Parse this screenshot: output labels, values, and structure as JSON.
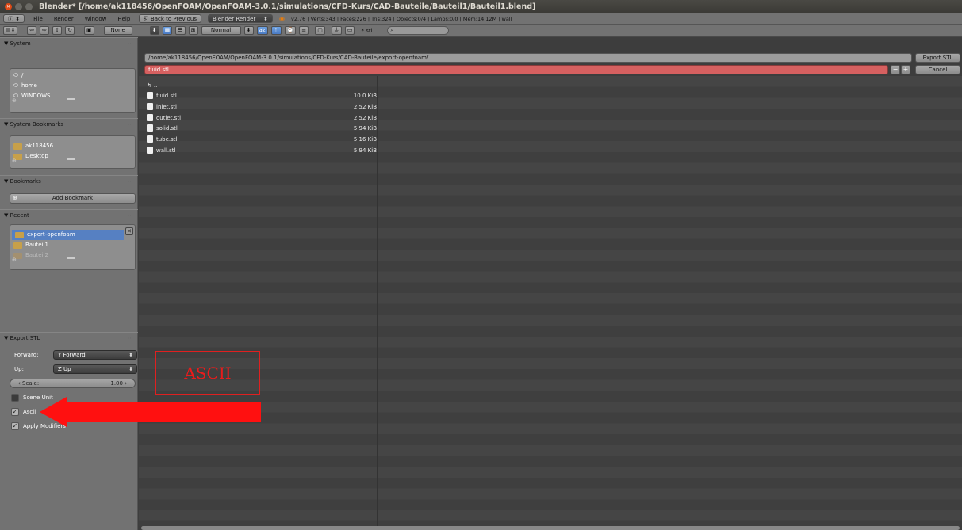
{
  "window": {
    "title": "Blender* [/home/ak118456/OpenFOAM/OpenFOAM-3.0.1/simulations/CFD-Kurs/CAD-Bauteile/Bauteil1/Bauteil1.blend]"
  },
  "infobar": {
    "menus": [
      "File",
      "Render",
      "Window",
      "Help"
    ],
    "back_button": "Back to Previous",
    "render_engine": "Blender Render",
    "stats": "v2.76 | Verts:343 | Faces:226 | Tris:324 | Objects:0/4 | Lamps:0/0 | Mem:14.12M | wall"
  },
  "fbheader": {
    "none_label": "None",
    "display_mode": "Normal",
    "filter_label": "*.stl",
    "search_placeholder": ""
  },
  "left": {
    "system": {
      "header": "▼ System",
      "items": [
        "/",
        "home",
        "WINDOWS"
      ]
    },
    "system_bookmarks": {
      "header": "▼ System Bookmarks",
      "items": [
        "ak118456",
        "Desktop"
      ]
    },
    "bookmarks": {
      "header": "▼ Bookmarks",
      "add_button": "Add Bookmark"
    },
    "recent": {
      "header": "▼ Recent",
      "items": [
        "export-openfoam",
        "Bauteil1",
        "Bauteil2"
      ]
    },
    "export_stl": {
      "header": "▼ Export STL",
      "forward_label": "Forward:",
      "forward_value": "Y Forward",
      "up_label": "Up:",
      "up_value": "Z Up",
      "scale_label": "Scale:",
      "scale_value": "1.00",
      "scene_unit": "Scene Unit",
      "scene_unit_checked": false,
      "ascii": "Ascii",
      "ascii_checked": true,
      "apply_modifiers": "Apply Modifiers",
      "apply_modifiers_checked": true
    }
  },
  "main": {
    "path": "/home/ak118456/OpenFOAM/OpenFOAM-3.0.1/simulations/CFD-Kurs/CAD-Bauteile/export-openfoam/",
    "filename": "fluid.stl",
    "export_button": "Export STL",
    "cancel_button": "Cancel",
    "parent_dir": "..",
    "files": [
      {
        "name": "fluid.stl",
        "size": "10.0 KiB"
      },
      {
        "name": "inlet.stl",
        "size": "2.52 KiB"
      },
      {
        "name": "outlet.stl",
        "size": "2.52 KiB"
      },
      {
        "name": "solid.stl",
        "size": "5.94 KiB"
      },
      {
        "name": "tube.stl",
        "size": "5.16 KiB"
      },
      {
        "name": "wall.stl",
        "size": "5.94 KiB"
      }
    ]
  },
  "annotation": {
    "label": "ASCII",
    "color": "#ff1010"
  }
}
